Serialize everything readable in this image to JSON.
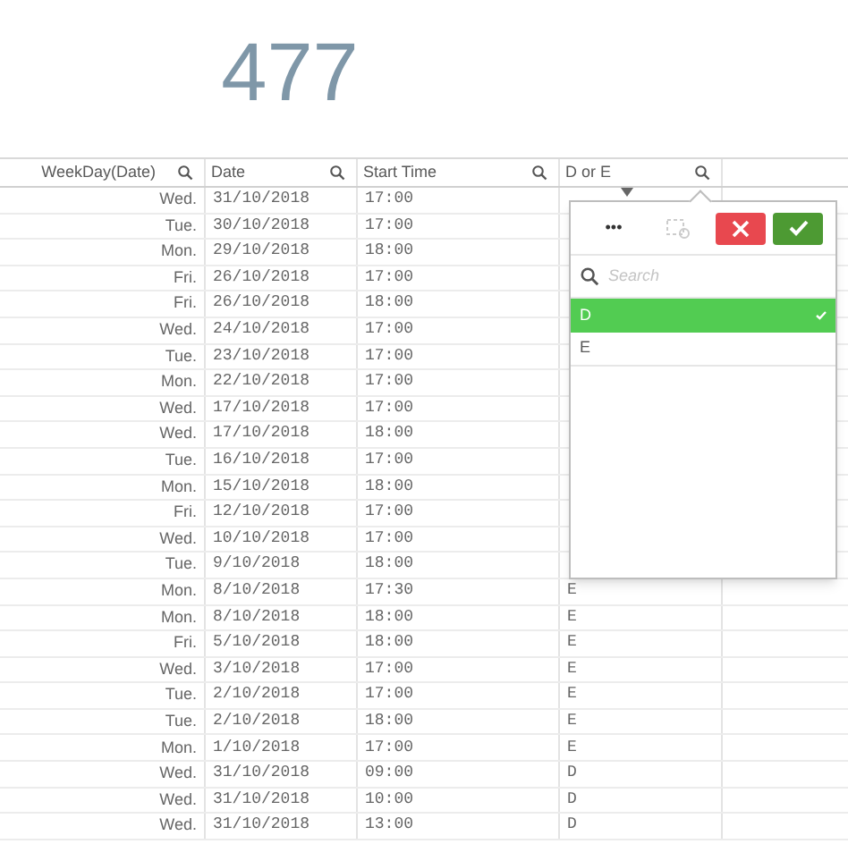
{
  "kpi": {
    "value": "477"
  },
  "table": {
    "columns": [
      {
        "label": "WeekDay(Date)"
      },
      {
        "label": "Date"
      },
      {
        "label": "Start Time"
      },
      {
        "label": "D or E"
      }
    ],
    "rows": [
      {
        "cells": [
          "Wed.",
          "31/10/2018",
          "17:00"
        ]
      },
      {
        "cells": [
          "Tue.",
          "30/10/2018",
          "17:00"
        ]
      },
      {
        "cells": [
          "Mon.",
          "29/10/2018",
          "18:00"
        ]
      },
      {
        "cells": [
          "Fri.",
          "26/10/2018",
          "17:00"
        ]
      },
      {
        "cells": [
          "Fri.",
          "26/10/2018",
          "18:00"
        ]
      },
      {
        "cells": [
          "Wed.",
          "24/10/2018",
          "17:00"
        ]
      },
      {
        "cells": [
          "Tue.",
          "23/10/2018",
          "17:00"
        ]
      },
      {
        "cells": [
          "Mon.",
          "22/10/2018",
          "17:00"
        ]
      },
      {
        "cells": [
          "Wed.",
          "17/10/2018",
          "17:00"
        ]
      },
      {
        "cells": [
          "Wed.",
          "17/10/2018",
          "18:00"
        ]
      },
      {
        "cells": [
          "Tue.",
          "16/10/2018",
          "17:00"
        ]
      },
      {
        "cells": [
          "Mon.",
          "15/10/2018",
          "18:00"
        ]
      },
      {
        "cells": [
          "Fri.",
          "12/10/2018",
          "17:00"
        ]
      },
      {
        "cells": [
          "Wed.",
          "10/10/2018",
          "17:00"
        ]
      },
      {
        "cells": [
          "Tue.",
          "9/10/2018",
          "18:00"
        ]
      },
      {
        "cells": [
          "Mon.",
          "8/10/2018",
          "17:30",
          "E"
        ]
      },
      {
        "cells": [
          "Mon.",
          "8/10/2018",
          "18:00",
          "E"
        ]
      },
      {
        "cells": [
          "Fri.",
          "5/10/2018",
          "18:00",
          "E"
        ]
      },
      {
        "cells": [
          "Wed.",
          "3/10/2018",
          "17:00",
          "E"
        ]
      },
      {
        "cells": [
          "Tue.",
          "2/10/2018",
          "17:00",
          "E"
        ]
      },
      {
        "cells": [
          "Tue.",
          "2/10/2018",
          "18:00",
          "E"
        ]
      },
      {
        "cells": [
          "Mon.",
          "1/10/2018",
          "17:00",
          "E"
        ]
      },
      {
        "cells": [
          "Wed.",
          "31/10/2018",
          "09:00",
          "D"
        ]
      },
      {
        "cells": [
          "Wed.",
          "31/10/2018",
          "10:00",
          "D"
        ]
      },
      {
        "cells": [
          "Wed.",
          "31/10/2018",
          "13:00",
          "D"
        ]
      }
    ]
  },
  "filter_popup": {
    "more_label": "•••",
    "search": {
      "placeholder": "Search"
    },
    "items": [
      {
        "label": "D",
        "selected": true
      },
      {
        "label": "E",
        "selected": false
      }
    ]
  }
}
